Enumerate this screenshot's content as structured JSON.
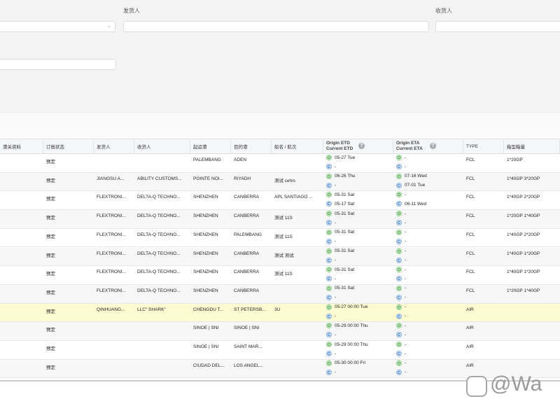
{
  "filters": {
    "shipper_label": "发货人",
    "consignee_label": "收货人"
  },
  "table": {
    "headers": [
      "港关资料",
      "订舱状态",
      "发货人",
      "收货人",
      "起运港",
      "目的港",
      "船名 / 航次",
      "Origin ETD",
      "Current ETD",
      "Origin ETA",
      "Current ETA",
      "TYPE",
      "箱型箱量"
    ],
    "rows": [
      {
        "status": "预定",
        "shipper": "",
        "consignee": "",
        "pol": "PALEMBANG",
        "pod": "ADEN",
        "vessel": "",
        "etd_o": "05-27 Tue",
        "etd_c": "-",
        "eta_o": "-",
        "eta_c": "-",
        "type": "FCL",
        "qty": "1*20GP"
      },
      {
        "status": "预定",
        "shipper": "JIANGSU A...",
        "consignee": "ABILITY CUSTOMS...",
        "pol": "POINTE NOI...",
        "pod": "RIYADH",
        "vessel": "测试 cehis",
        "etd_o": "06-26 Thu",
        "etd_c": "-",
        "eta_o": "07-16 Wed",
        "eta_c": "07-01 Tue",
        "type": "FCL",
        "qty": "1*40GP 3*20GP"
      },
      {
        "status": "预定",
        "shipper": "FLEXTRONI...",
        "consignee": "DELTA-Q TECHNO...",
        "pol": "SHENZHEN",
        "pod": "CANBERRA",
        "vessel": "APL SANTIAGO ...",
        "etd_o": "05-31 Sat",
        "etd_c": "05-17 Sat",
        "eta_o": "-",
        "eta_c": "06-11 Wed",
        "type": "FCL",
        "qty": "1*40GP 2*20GP"
      },
      {
        "status": "预定",
        "shipper": "FLEXTRONI...",
        "consignee": "DELTA-Q TECHNO...",
        "pol": "SHENZHEN",
        "pod": "CANBERRA",
        "vessel": "测试 11S",
        "etd_o": "05-31 Sat",
        "etd_c": "-",
        "eta_o": "-",
        "eta_c": "-",
        "type": "FCL",
        "qty": "1*20GP 1*40GP"
      },
      {
        "status": "预定",
        "shipper": "FLEXTRONI...",
        "consignee": "DELTA-Q TECHNO...",
        "pol": "SHENZHEN",
        "pod": "PALEMBANG",
        "vessel": "测试 11S",
        "etd_o": "05-31 Sat",
        "etd_c": "-",
        "eta_o": "-",
        "eta_c": "-",
        "type": "FCL",
        "qty": "1*40GP 2*20GP"
      },
      {
        "status": "预定",
        "shipper": "FLEXTRONI...",
        "consignee": "DELTA-Q TECHNO...",
        "pol": "SHENZHEN",
        "pod": "CANBERRA",
        "vessel": "测试 测试",
        "etd_o": "05-31 Sat",
        "etd_c": "-",
        "eta_o": "-",
        "eta_c": "-",
        "type": "FCL",
        "qty": "1*40GP 1*20GP"
      },
      {
        "status": "预定",
        "shipper": "FLEXTRONI...",
        "consignee": "DELTA-Q TECHNO...",
        "pol": "SHENZHEN",
        "pod": "CANBERRA",
        "vessel": "测试 11S",
        "etd_o": "05-31 Sat",
        "etd_c": "-",
        "eta_o": "-",
        "eta_c": "-",
        "type": "FCL",
        "qty": "1*40GP 1*20GP"
      },
      {
        "status": "预定",
        "shipper": "FLEXTRONI...",
        "consignee": "DELTA-Q TECHNO...",
        "pol": "SHENZHEN",
        "pod": "CANBERRA",
        "vessel": "",
        "etd_o": "05-31 Sat",
        "etd_c": "-",
        "eta_o": "-",
        "eta_c": "-",
        "type": "FCL",
        "qty": "1*20GP 1*40GP"
      },
      {
        "status": "预定",
        "shipper": "QINHUANG...",
        "consignee": "LLC\" SHARK\"",
        "pol": "CHENGDU T...",
        "pod": "ST PETERSB...",
        "vessel": "3U",
        "etd_o": "05-27 00:00 Tue",
        "etd_c": "-",
        "eta_o": "-",
        "eta_c": "-",
        "type": "AIR",
        "qty": ""
      },
      {
        "status": "预定",
        "shipper": "",
        "consignee": "",
        "pol": "SINOE | SNI",
        "pod": "SINOE | SNI",
        "vessel": "",
        "etd_o": "05-29 00:00 Thu",
        "etd_c": "-",
        "eta_o": "-",
        "eta_c": "-",
        "type": "AIR",
        "qty": ""
      },
      {
        "status": "预定",
        "shipper": "",
        "consignee": "",
        "pol": "SINOE | SNI",
        "pod": "SAINT MAR...",
        "vessel": "",
        "etd_o": "05-29 00:00 Thu",
        "etd_c": "-",
        "eta_o": "-",
        "eta_c": "-",
        "type": "AIR",
        "qty": ""
      },
      {
        "status": "预定",
        "shipper": "",
        "consignee": "",
        "pol": "CIUDAD DEL...",
        "pod": "LOS ANGEL...",
        "vessel": "",
        "etd_o": "05-30 00:00 Fri",
        "etd_c": "-",
        "eta_o": "-",
        "eta_c": "-",
        "type": "AIR",
        "qty": ""
      }
    ],
    "highlight_row": 8,
    "highlight_color": "#fdfbd1"
  },
  "badges": {
    "origin": "O",
    "current": "C",
    "help": "?"
  },
  "watermark": "@Wa"
}
